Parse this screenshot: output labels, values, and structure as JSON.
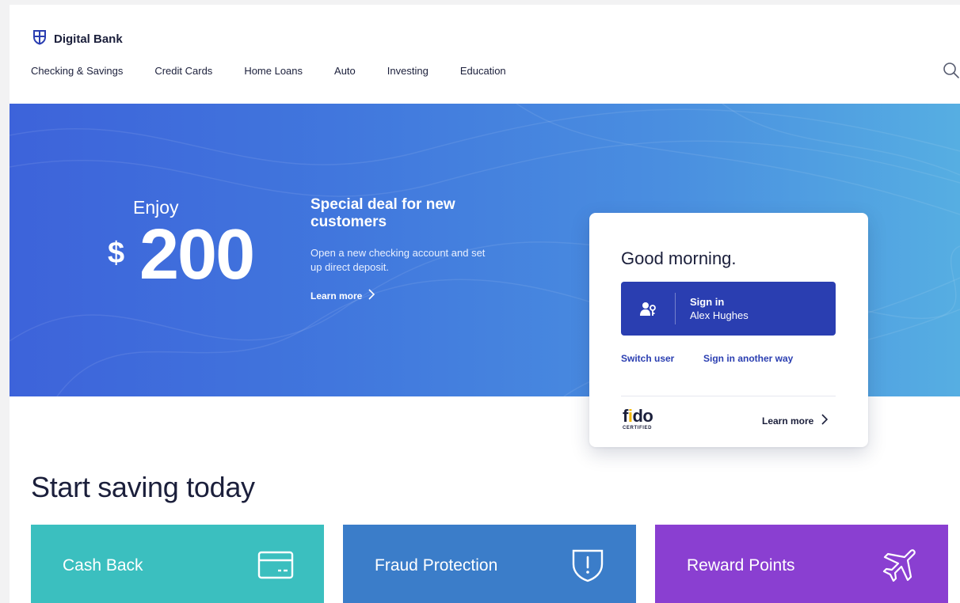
{
  "brand": {
    "name": "Digital Bank"
  },
  "nav": {
    "items": [
      {
        "label": "Checking & Savings"
      },
      {
        "label": "Credit Cards"
      },
      {
        "label": "Home Loans"
      },
      {
        "label": "Auto"
      },
      {
        "label": "Investing"
      },
      {
        "label": "Education"
      }
    ],
    "search_icon": "search-icon"
  },
  "hero": {
    "enjoy": "Enjoy",
    "currency": "$",
    "amount": "200",
    "deal_title": "Special deal for new customers",
    "deal_desc": "Open a new checking account and set up direct deposit.",
    "learn_more": "Learn more"
  },
  "signin_card": {
    "greeting": "Good morning.",
    "signin_label": "Sign in",
    "user_name": "Alex Hughes",
    "switch_user": "Switch user",
    "sign_in_another_way": "Sign in another way",
    "fido_logo_text": "fido",
    "fido_cert": "CERTIFIED",
    "learn_more": "Learn more"
  },
  "savings": {
    "title": "Start saving today",
    "tiles": [
      {
        "label": "Cash Back",
        "color": "#3bbfbf",
        "icon": "credit-card-icon"
      },
      {
        "label": "Fraud Protection",
        "color": "#3b7dc9",
        "icon": "shield-alert-icon"
      },
      {
        "label": "Reward Points",
        "color": "#8a3fd1",
        "icon": "airplane-icon"
      }
    ]
  },
  "colors": {
    "primary": "#2a3eb1",
    "hero_start": "#3d63da",
    "hero_end": "#56aee2",
    "text_dark": "#1b1f3b"
  }
}
